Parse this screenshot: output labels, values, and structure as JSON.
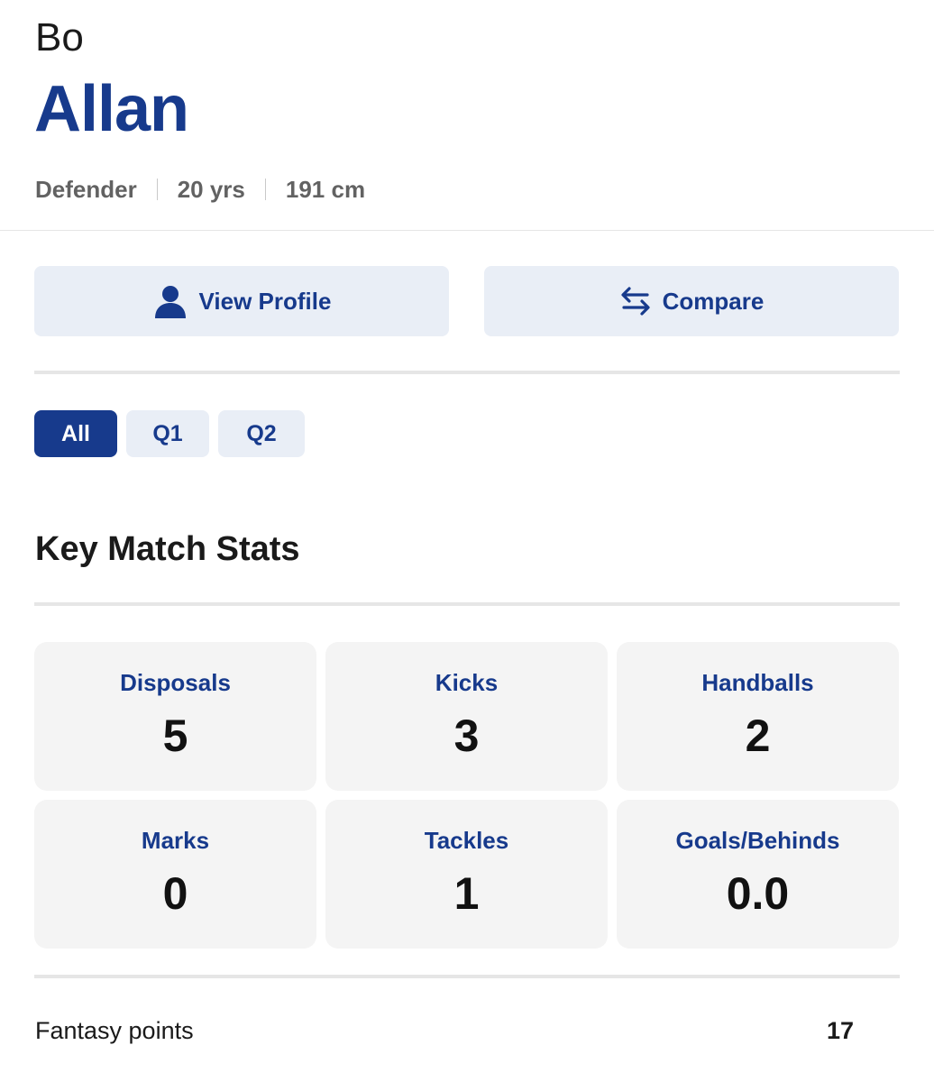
{
  "player": {
    "first_name": "Bo",
    "last_name": "Allan",
    "position": "Defender",
    "age": "20 yrs",
    "height": "191 cm"
  },
  "actions": {
    "view_profile": {
      "label": "View Profile",
      "icon": "person-icon"
    },
    "compare": {
      "label": "Compare",
      "icon": "swap-arrows-icon"
    }
  },
  "tabs": [
    {
      "label": "All",
      "active": true
    },
    {
      "label": "Q1",
      "active": false
    },
    {
      "label": "Q2",
      "active": false
    }
  ],
  "key_stats": {
    "title": "Key Match Stats",
    "items": [
      {
        "label": "Disposals",
        "value": "5"
      },
      {
        "label": "Kicks",
        "value": "3"
      },
      {
        "label": "Handballs",
        "value": "2"
      },
      {
        "label": "Marks",
        "value": "0"
      },
      {
        "label": "Tackles",
        "value": "1"
      },
      {
        "label": "Goals/Behinds",
        "value": "0.0"
      }
    ]
  },
  "fantasy": {
    "label": "Fantasy points",
    "value": "17"
  },
  "colors": {
    "brand_blue": "#173a8c",
    "button_bg": "#e9eef6",
    "card_bg": "#f4f4f4",
    "divider": "#e6e6e6"
  }
}
